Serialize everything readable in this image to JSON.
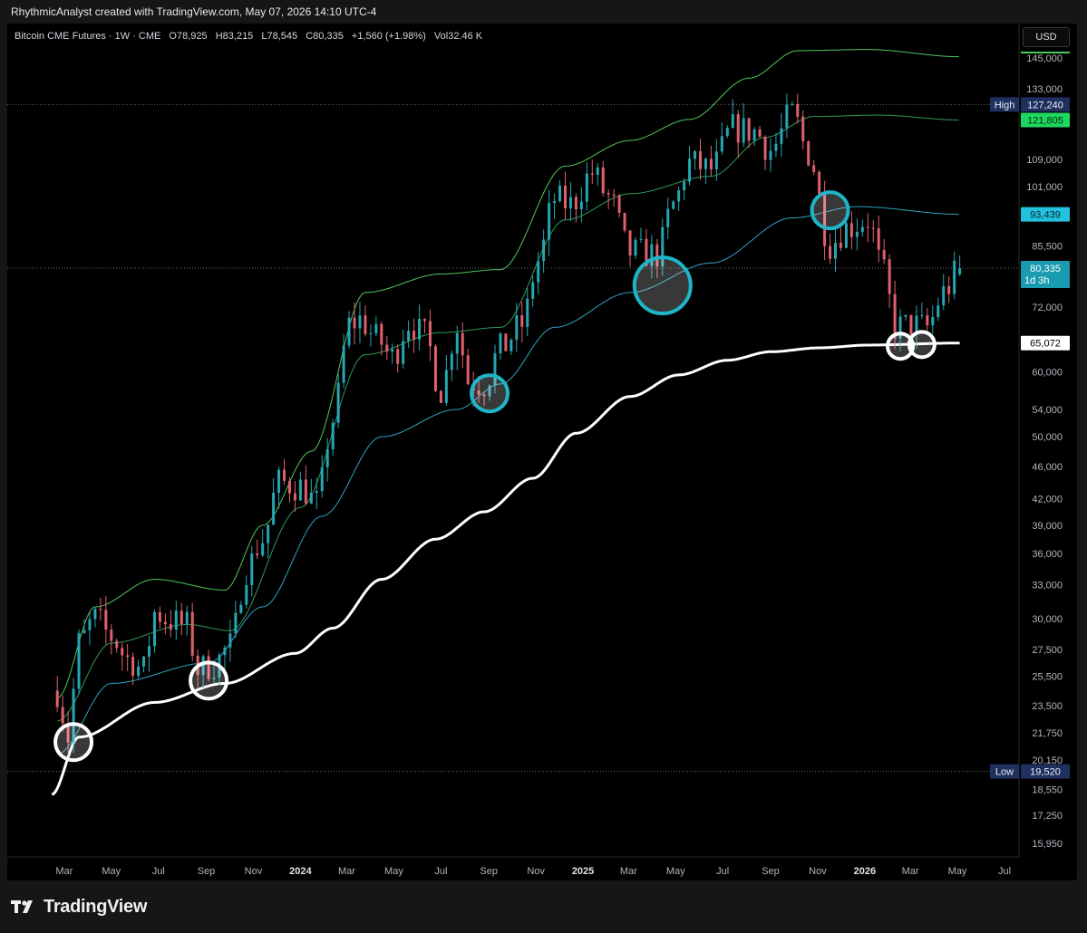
{
  "attribution": "RhythmicAnalyst created with TradingView.com, May 07, 2026 14:10 UTC-4",
  "legend": {
    "symbol": "Bitcoin CME Futures · 1W · CME",
    "o_label": "O",
    "o_value": "78,925",
    "h_label": "H",
    "h_value": "83,215",
    "l_label": "L",
    "l_value": "78,545",
    "c_label": "C",
    "c_value": "80,335",
    "change": "+1,560 (+1.98%)",
    "vol_label": "Vol",
    "vol_value": "32.46 K"
  },
  "currency": "USD",
  "brand": "TradingView",
  "colors": {
    "up": "#26a6b3",
    "down": "#e0606c",
    "upper_band": "#4ec95b",
    "mid_band": "#2e9a57",
    "lower_band": "#2fa3c0",
    "long_ma": "#ffffff",
    "circle_cyan": "#1fb5c8"
  },
  "chart_data": {
    "type": "candlestick",
    "timeframe": "1W",
    "price_scale": "log",
    "ylim": [
      14900,
      158000
    ],
    "x_ticks": [
      "Mar",
      "May",
      "Jul",
      "Sep",
      "Nov",
      "2024",
      "Mar",
      "May",
      "Jul",
      "Sep",
      "Nov",
      "2025",
      "Mar",
      "May",
      "Jul",
      "Sep",
      "Nov",
      "2026",
      "Mar",
      "May",
      "Jul"
    ],
    "y_ticks": [
      "145,000",
      "133,000",
      "109,000",
      "101,000",
      "85,500",
      "72,000",
      "60,000",
      "54,000",
      "50,000",
      "46,000",
      "42,000",
      "39,000",
      "36,000",
      "33,000",
      "30,000",
      "27,500",
      "25,500",
      "23,500",
      "21,750",
      "20,150",
      "18,550",
      "17,250",
      "15,950"
    ],
    "price_labels": [
      {
        "tag": "High",
        "text": "127,240",
        "value": 127240,
        "style": "navy",
        "line": "dotted"
      },
      {
        "tag": "",
        "text": "121,805",
        "value": 121805,
        "style": "green"
      },
      {
        "tag": "",
        "text": "93,439",
        "value": 93439,
        "style": "cyan"
      },
      {
        "tag": "",
        "text": "80,335",
        "sub": "1d 3h",
        "value": 80335,
        "style": "teal",
        "line": "dotted"
      },
      {
        "tag": "",
        "text": "65,072",
        "value": 65072,
        "style": "white"
      },
      {
        "tag": "Low",
        "text": "19,520",
        "value": 19520,
        "style": "navy",
        "line": "dotted"
      }
    ],
    "close_series": [
      [
        "2023-02-20",
        24500
      ],
      [
        "2023-03-06",
        21500
      ],
      [
        "2023-03-20",
        28000
      ],
      [
        "2023-04-10",
        30000
      ],
      [
        "2023-05-01",
        28500
      ],
      [
        "2023-05-22",
        26800
      ],
      [
        "2023-06-12",
        26000
      ],
      [
        "2023-06-26",
        30500
      ],
      [
        "2023-07-17",
        29800
      ],
      [
        "2023-08-07",
        29400
      ],
      [
        "2023-08-21",
        26000
      ],
      [
        "2023-09-11",
        26400
      ],
      [
        "2023-10-02",
        27800
      ],
      [
        "2023-10-23",
        34500
      ],
      [
        "2023-11-13",
        37500
      ],
      [
        "2023-12-04",
        44000
      ],
      [
        "2024-01-01",
        43500
      ],
      [
        "2024-01-22",
        41500
      ],
      [
        "2024-02-12",
        52500
      ],
      [
        "2024-03-04",
        68500
      ],
      [
        "2024-03-18",
        69500
      ],
      [
        "2024-04-08",
        66000
      ],
      [
        "2024-04-29",
        62500
      ],
      [
        "2024-05-20",
        69000
      ],
      [
        "2024-06-10",
        66500
      ],
      [
        "2024-07-01",
        57000
      ],
      [
        "2024-07-22",
        68500
      ],
      [
        "2024-08-05",
        58500
      ],
      [
        "2024-08-26",
        58000
      ],
      [
        "2024-09-16",
        64000
      ],
      [
        "2024-10-14",
        68500
      ],
      [
        "2024-11-04",
        82000
      ],
      [
        "2024-11-25",
        97500
      ],
      [
        "2024-12-16",
        96000
      ],
      [
        "2025-01-13",
        105000
      ],
      [
        "2025-02-03",
        98000
      ],
      [
        "2025-03-03",
        84000
      ],
      [
        "2025-04-07",
        83500
      ],
      [
        "2025-04-28",
        96000
      ],
      [
        "2025-05-19",
        108000
      ],
      [
        "2025-06-16",
        106000
      ],
      [
        "2025-07-14",
        119000
      ],
      [
        "2025-08-11",
        118000
      ],
      [
        "2025-09-01",
        112000
      ],
      [
        "2025-09-29",
        124000
      ],
      [
        "2025-10-20",
        111000
      ],
      [
        "2025-11-17",
        86000
      ],
      [
        "2025-12-08",
        90000
      ],
      [
        "2026-01-05",
        92000
      ],
      [
        "2026-01-26",
        79000
      ],
      [
        "2026-02-09",
        68000
      ],
      [
        "2026-03-02",
        68500
      ],
      [
        "2026-03-23",
        68000
      ],
      [
        "2026-04-13",
        75000
      ],
      [
        "2026-05-04",
        80335
      ]
    ],
    "bands": {
      "upper": [
        [
          "2023-02-20",
          24000
        ],
        [
          "2023-04-10",
          31000
        ],
        [
          "2023-06-26",
          33500
        ],
        [
          "2023-09-25",
          32500
        ],
        [
          "2023-11-13",
          39000
        ],
        [
          "2024-01-15",
          48000
        ],
        [
          "2024-03-25",
          75000
        ],
        [
          "2024-07-01",
          79000
        ],
        [
          "2024-09-16",
          80000
        ],
        [
          "2024-12-09",
          107000
        ],
        [
          "2025-03-03",
          115000
        ],
        [
          "2025-05-19",
          122000
        ],
        [
          "2025-08-04",
          137000
        ],
        [
          "2025-10-06",
          148000
        ],
        [
          "2026-01-05",
          148500
        ],
        [
          "2026-05-04",
          145500
        ]
      ],
      "middle": [
        [
          "2023-02-20",
          22500
        ],
        [
          "2023-05-01",
          28000
        ],
        [
          "2023-08-07",
          29500
        ],
        [
          "2023-10-02",
          29000
        ],
        [
          "2024-01-01",
          41000
        ],
        [
          "2024-03-25",
          63000
        ],
        [
          "2024-07-01",
          67000
        ],
        [
          "2024-09-16",
          68000
        ],
        [
          "2024-12-09",
          92000
        ],
        [
          "2025-03-03",
          99000
        ],
        [
          "2025-06-16",
          104000
        ],
        [
          "2025-08-25",
          116000
        ],
        [
          "2025-10-27",
          123000
        ],
        [
          "2026-01-19",
          123500
        ],
        [
          "2026-05-04",
          121805
        ]
      ],
      "lower": [
        [
          "2023-02-20",
          20500
        ],
        [
          "2023-05-01",
          25000
        ],
        [
          "2023-09-04",
          26500
        ],
        [
          "2023-11-13",
          31000
        ],
        [
          "2024-01-29",
          40000
        ],
        [
          "2024-04-15",
          50000
        ],
        [
          "2024-07-22",
          54000
        ],
        [
          "2024-09-16",
          58000
        ],
        [
          "2024-11-25",
          68000
        ],
        [
          "2025-03-03",
          75000
        ],
        [
          "2025-06-16",
          81500
        ],
        [
          "2025-09-29",
          92500
        ],
        [
          "2025-12-22",
          95500
        ],
        [
          "2026-05-04",
          93439
        ]
      ],
      "long_ma": [
        [
          "2023-02-13",
          18300
        ],
        [
          "2023-03-20",
          21500
        ],
        [
          "2023-06-26",
          23700
        ],
        [
          "2023-09-25",
          25000
        ],
        [
          "2023-12-25",
          27200
        ],
        [
          "2024-02-12",
          29200
        ],
        [
          "2024-04-15",
          33500
        ],
        [
          "2024-06-24",
          37500
        ],
        [
          "2024-08-26",
          40500
        ],
        [
          "2024-10-28",
          44500
        ],
        [
          "2024-12-23",
          50500
        ],
        [
          "2025-03-03",
          56000
        ],
        [
          "2025-05-05",
          59500
        ],
        [
          "2025-07-07",
          62000
        ],
        [
          "2025-09-01",
          63500
        ],
        [
          "2025-11-03",
          64200
        ],
        [
          "2026-01-05",
          64700
        ],
        [
          "2026-05-04",
          65072
        ]
      ]
    },
    "highlight_circles": [
      {
        "date": "2023-03-13",
        "price": 21200,
        "size": "medium",
        "color": "white"
      },
      {
        "date": "2023-09-04",
        "price": 25200,
        "size": "medium",
        "color": "white"
      },
      {
        "date": "2024-09-02",
        "price": 56500,
        "size": "medium",
        "color": "cyan"
      },
      {
        "date": "2025-04-14",
        "price": 76500,
        "size": "large",
        "color": "cyan"
      },
      {
        "date": "2025-11-17",
        "price": 94500,
        "size": "medium",
        "color": "cyan"
      },
      {
        "date": "2026-02-16",
        "price": 64500,
        "size": "small",
        "color": "white"
      },
      {
        "date": "2026-03-16",
        "price": 64800,
        "size": "small",
        "color": "white"
      }
    ]
  }
}
